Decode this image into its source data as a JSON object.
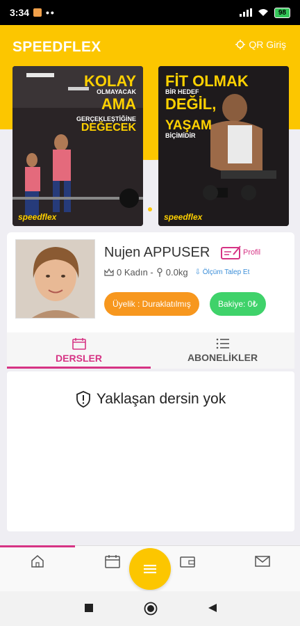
{
  "status_bar": {
    "time": "3:34",
    "dots": "••",
    "battery": "98"
  },
  "header": {
    "app_title": "SPEEDFLEX",
    "qr_label": "QR Giriş"
  },
  "banners": [
    {
      "lines": [
        "KOLAY",
        "OLMAYACAK",
        "AMA",
        "GERÇEKLEŞTİĞİNE",
        "DEĞECEK"
      ],
      "brand": "speedflex"
    },
    {
      "lines": [
        "FİT OLMAK",
        "BİR HEDEF",
        "DEĞİL,",
        "YAŞAM",
        "BİÇİMİDİR"
      ],
      "brand": "speedflex"
    }
  ],
  "profile": {
    "name": "Nujen APPUSER",
    "profil_label": "Profil",
    "stats_kadin": "0 Kadın -",
    "stats_weight": "0.0kg",
    "measure_link": "Ölçüm Talep Et",
    "membership": "Üyelik : Duraklatılmış",
    "balance": "Bakiye: 0₺"
  },
  "tabs": [
    {
      "label": "DERSLER",
      "active": true,
      "icon": "calendar-icon"
    },
    {
      "label": "ABONELİKLER",
      "active": false,
      "icon": "list-icon"
    }
  ],
  "empty_state": {
    "message": "Yaklaşan dersin yok",
    "icon": "shield-alert-icon"
  },
  "bottom_nav": {
    "items": [
      "home-icon",
      "calendar-icon",
      "menu-icon",
      "wallet-icon",
      "mail-icon"
    ]
  },
  "colors": {
    "brand_yellow": "#fcc600",
    "accent_pink": "#d63384",
    "orange": "#f7971e",
    "green": "#3fd26a"
  }
}
